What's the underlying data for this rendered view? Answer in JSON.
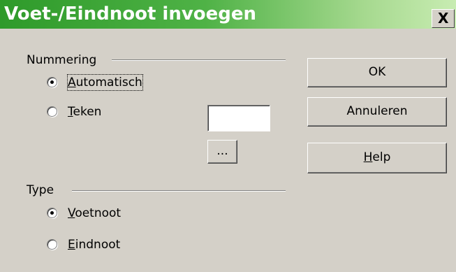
{
  "window": {
    "title": "Voet-/Eindnoot invoegen",
    "close_label": "X"
  },
  "numbering": {
    "label": "Nummering",
    "options": [
      {
        "accel": "A",
        "rest": "utomatisch",
        "selected": true
      },
      {
        "accel": "T",
        "rest": "eken",
        "selected": false
      }
    ],
    "char_value": "",
    "browse_label": "..."
  },
  "type": {
    "label": "Type",
    "options": [
      {
        "accel": "V",
        "rest": "oetnoot",
        "selected": true
      },
      {
        "accel": "E",
        "rest": "indnoot",
        "selected": false
      }
    ]
  },
  "buttons": {
    "ok": "OK",
    "cancel": "Annuleren",
    "help_accel": "H",
    "help_rest": "elp"
  }
}
